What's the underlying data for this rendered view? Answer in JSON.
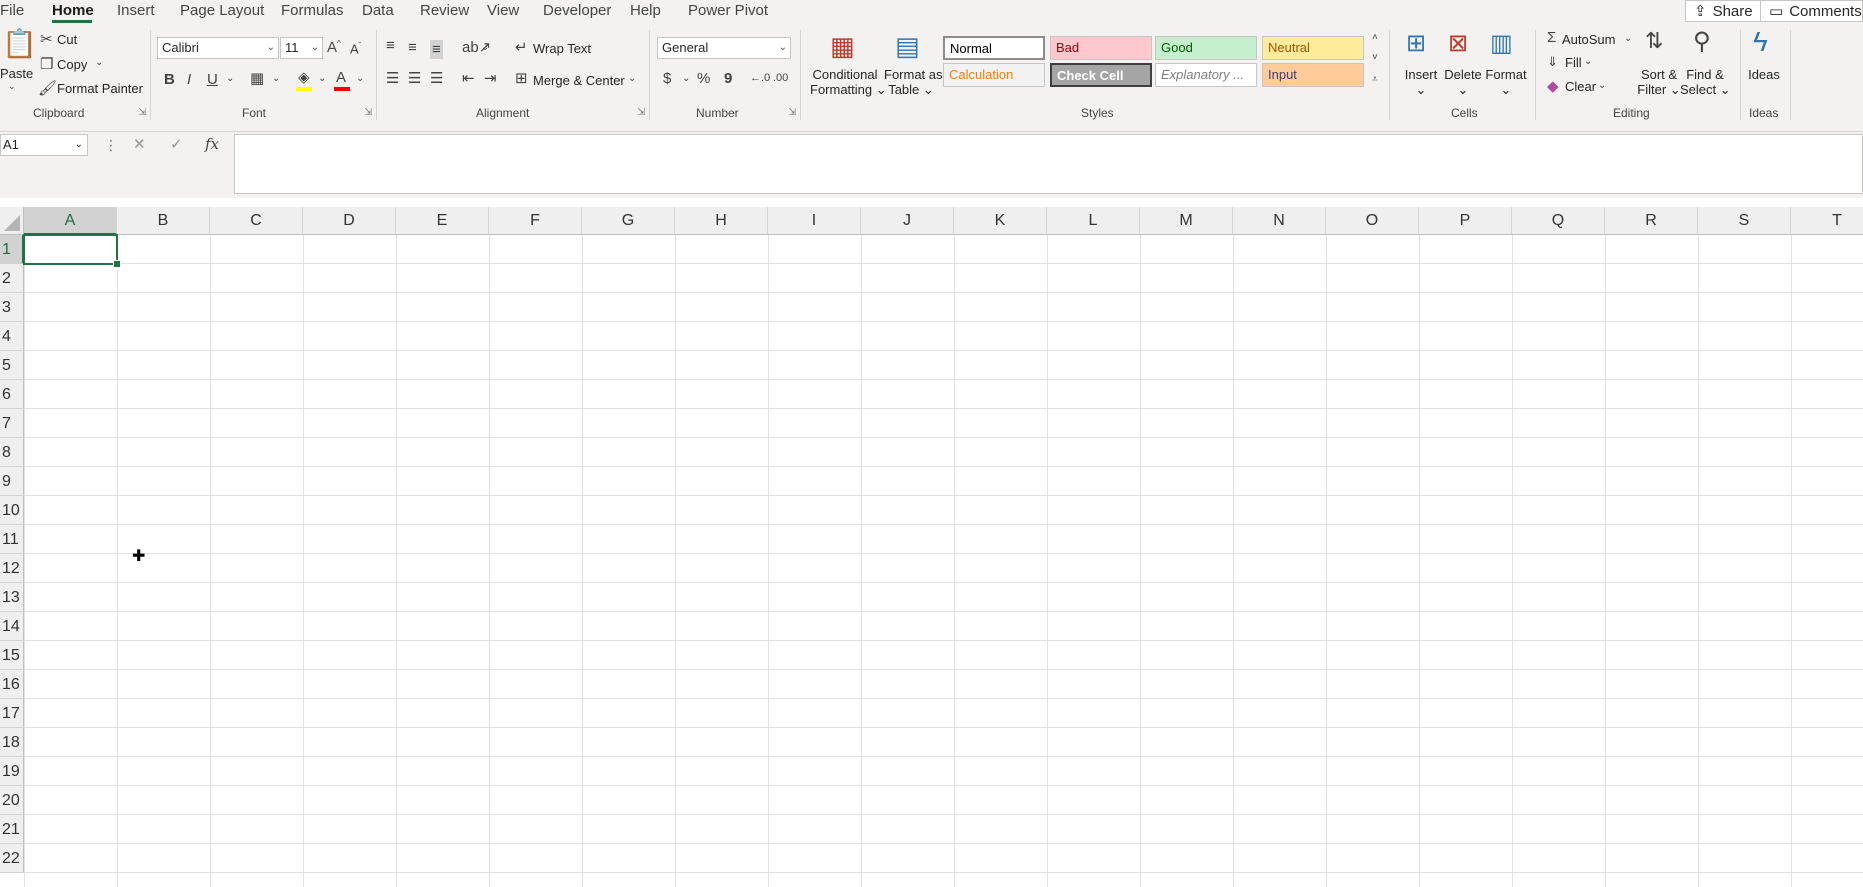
{
  "tabs": [
    "File",
    "Home",
    "Insert",
    "Page Layout",
    "Formulas",
    "Data",
    "Review",
    "View",
    "Developer",
    "Help",
    "Power Pivot"
  ],
  "active_tab": "Home",
  "top_buttons": {
    "share": "Share",
    "comments": "Comments"
  },
  "clipboard": {
    "paste": "Paste",
    "cut": "Cut",
    "copy": "Copy",
    "format_painter": "Format Painter",
    "group": "Clipboard"
  },
  "font": {
    "name": "Calibri",
    "size": "11",
    "bold": "B",
    "italic": "I",
    "underline": "U",
    "font_color_letter": "A",
    "group": "Font"
  },
  "alignment": {
    "wrap_text": "Wrap Text",
    "merge_center": "Merge & Center",
    "group": "Alignment"
  },
  "number": {
    "format": "General",
    "currency": "$",
    "percent": "%",
    "comma": "9",
    "group": "Number"
  },
  "styles": {
    "conditional_formatting_1": "Conditional",
    "conditional_formatting_2": "Formatting",
    "format_table_1": "Format as",
    "format_table_2": "Table",
    "cells": [
      {
        "label": "Normal",
        "bg": "#ffffff",
        "color": "#000000"
      },
      {
        "label": "Bad",
        "bg": "#ffc7ce",
        "color": "#9c0006"
      },
      {
        "label": "Good",
        "bg": "#c6efce",
        "color": "#006100"
      },
      {
        "label": "Neutral",
        "bg": "#ffeb9c",
        "color": "#9c5700"
      },
      {
        "label": "Calculation",
        "bg": "#f2f2f2",
        "color": "#fa7d00"
      },
      {
        "label": "Check Cell",
        "bg": "#a5a5a5",
        "color": "#ffffff"
      },
      {
        "label": "Explanatory ...",
        "bg": "#ffffff",
        "color": "#7f7f7f"
      },
      {
        "label": "Input",
        "bg": "#ffcc99",
        "color": "#3f3f76"
      }
    ],
    "group": "Styles"
  },
  "cells_group": {
    "insert": "Insert",
    "delete": "Delete",
    "format": "Format",
    "group": "Cells"
  },
  "editing": {
    "autosum": "AutoSum",
    "fill": "Fill",
    "clear": "Clear",
    "sort_filter_1": "Sort &",
    "sort_filter_2": "Filter",
    "find_select_1": "Find &",
    "find_select_2": "Select",
    "group": "Editing"
  },
  "ideas": {
    "label": "Ideas",
    "group": "Ideas"
  },
  "formula_bar": {
    "name_box": "A1",
    "fx": "fx",
    "value": ""
  },
  "grid": {
    "columns": [
      "A",
      "B",
      "C",
      "D",
      "E",
      "F",
      "G",
      "H",
      "I",
      "J",
      "K",
      "L",
      "M",
      "N",
      "O",
      "P",
      "Q",
      "R",
      "S",
      "T"
    ],
    "rows": [
      "1",
      "2",
      "3",
      "4",
      "5",
      "6",
      "7",
      "8",
      "9",
      "10",
      "11",
      "12",
      "13",
      "14",
      "15",
      "16",
      "17",
      "18",
      "19",
      "20",
      "21",
      "22"
    ],
    "active_cell": "A1"
  },
  "colors": {
    "accent": "#217346"
  }
}
